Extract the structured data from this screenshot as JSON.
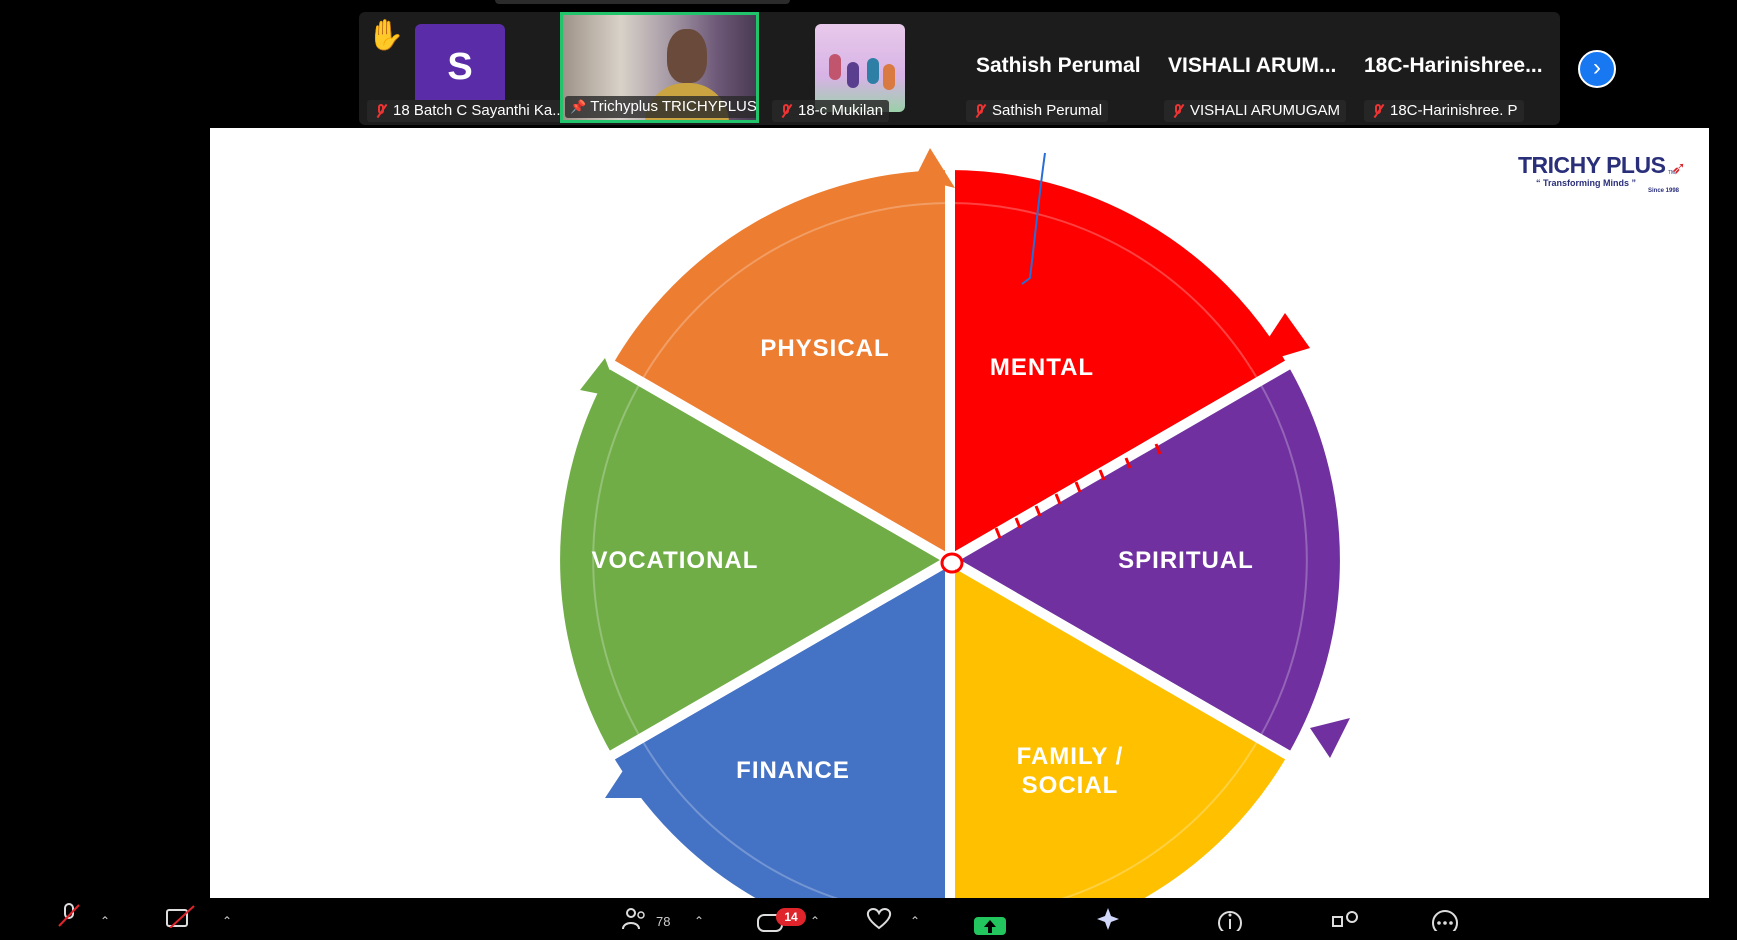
{
  "participants": {
    "raise_hand_icon": "raised-hand",
    "tiles": [
      {
        "name": "18 Batch C Sayanthi Ka...",
        "avatar_letter": "S",
        "avatar_color": "#5a2ca8",
        "muted": true
      },
      {
        "name": "Trichyplus TRICHYPLUS",
        "pinned": true,
        "active_speaker": true,
        "highlight_color": "#21c46b"
      },
      {
        "name": "18-c Mukilan",
        "muted": true
      },
      {
        "display_name": "Sathish Perumal",
        "name": "Sathish Perumal",
        "muted": true
      },
      {
        "display_name": "VISHALI  ARUM...",
        "name": "VISHALI ARUMUGAM",
        "muted": true
      },
      {
        "display_name": "18C-Harinishree...",
        "name": "18C-Harinishree. P",
        "muted": true
      }
    ],
    "next_page_icon": "chevron-right"
  },
  "slide": {
    "logo": {
      "brand": "TRICHY PLUS",
      "tagline": "“ Transforming Minds ”",
      "since": "Since 1998",
      "tm": "TM"
    },
    "wheel_segments": [
      {
        "label": "MENTAL",
        "color": "#fe0000"
      },
      {
        "label": "SPIRITUAL",
        "color": "#7030a0"
      },
      {
        "label": "FAMILY /",
        "label2": "SOCIAL",
        "color": "#ffc000"
      },
      {
        "label": "FINANCE",
        "color": "#4472c4"
      },
      {
        "label": "VOCATIONAL",
        "color": "#70ad47"
      },
      {
        "label": "PHYSICAL",
        "color": "#ed7d31"
      }
    ]
  },
  "toolbar": {
    "mic_icon": "mic-muted",
    "video_icon": "video-off",
    "participants_icon": "people",
    "participants_count": "78",
    "chat_icon": "chat",
    "chat_badge": "14",
    "reactions_icon": "heart",
    "share_icon": "share-screen",
    "ai_icon": "sparkle",
    "info_icon": "info",
    "apps_icon": "apps",
    "more_icon": "more"
  }
}
